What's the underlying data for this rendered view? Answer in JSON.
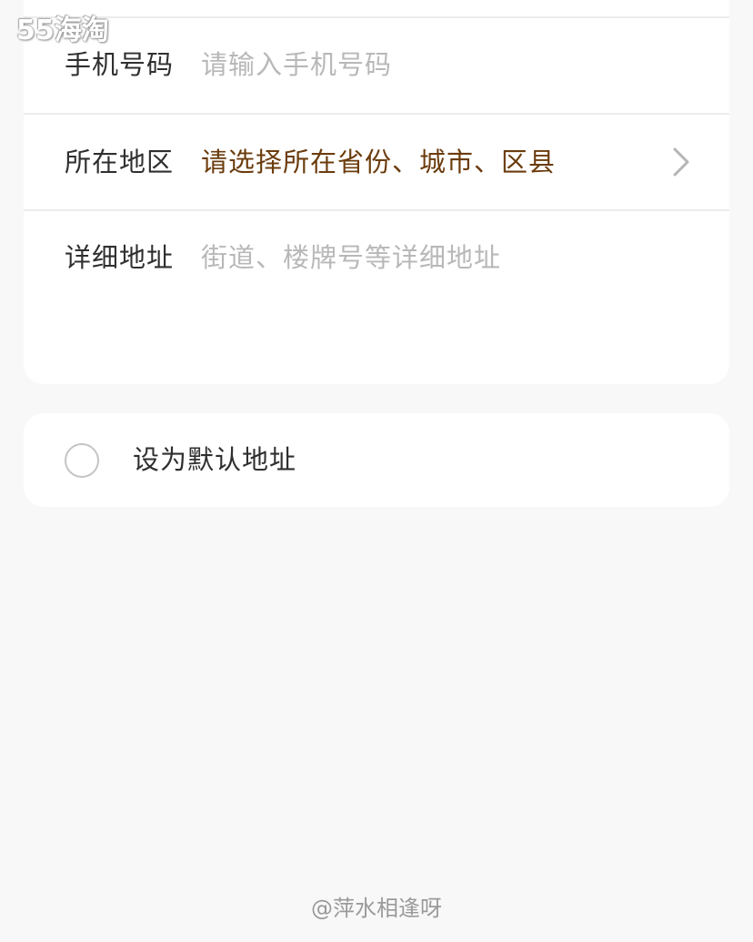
{
  "watermarks": {
    "top_left": "55海淘",
    "bottom": "@萍水相逢呀"
  },
  "form": {
    "phone": {
      "label": "手机号码",
      "placeholder": "请输入手机号码"
    },
    "region": {
      "label": "所在地区",
      "value": "请选择所在省份、城市、区县",
      "icon": "chevron-right-icon"
    },
    "address": {
      "label": "详细地址",
      "placeholder": "街道、楼牌号等详细地址"
    }
  },
  "default_option": {
    "label": "设为默认地址",
    "checked": false
  },
  "colors": {
    "background": "#f8f8f8",
    "card": "#ffffff",
    "label_text": "#2f2f2f",
    "placeholder_text": "#b8b8b8",
    "region_text": "#6b3c0d",
    "divider": "#ececec",
    "radio_border": "#c4c4c4"
  }
}
